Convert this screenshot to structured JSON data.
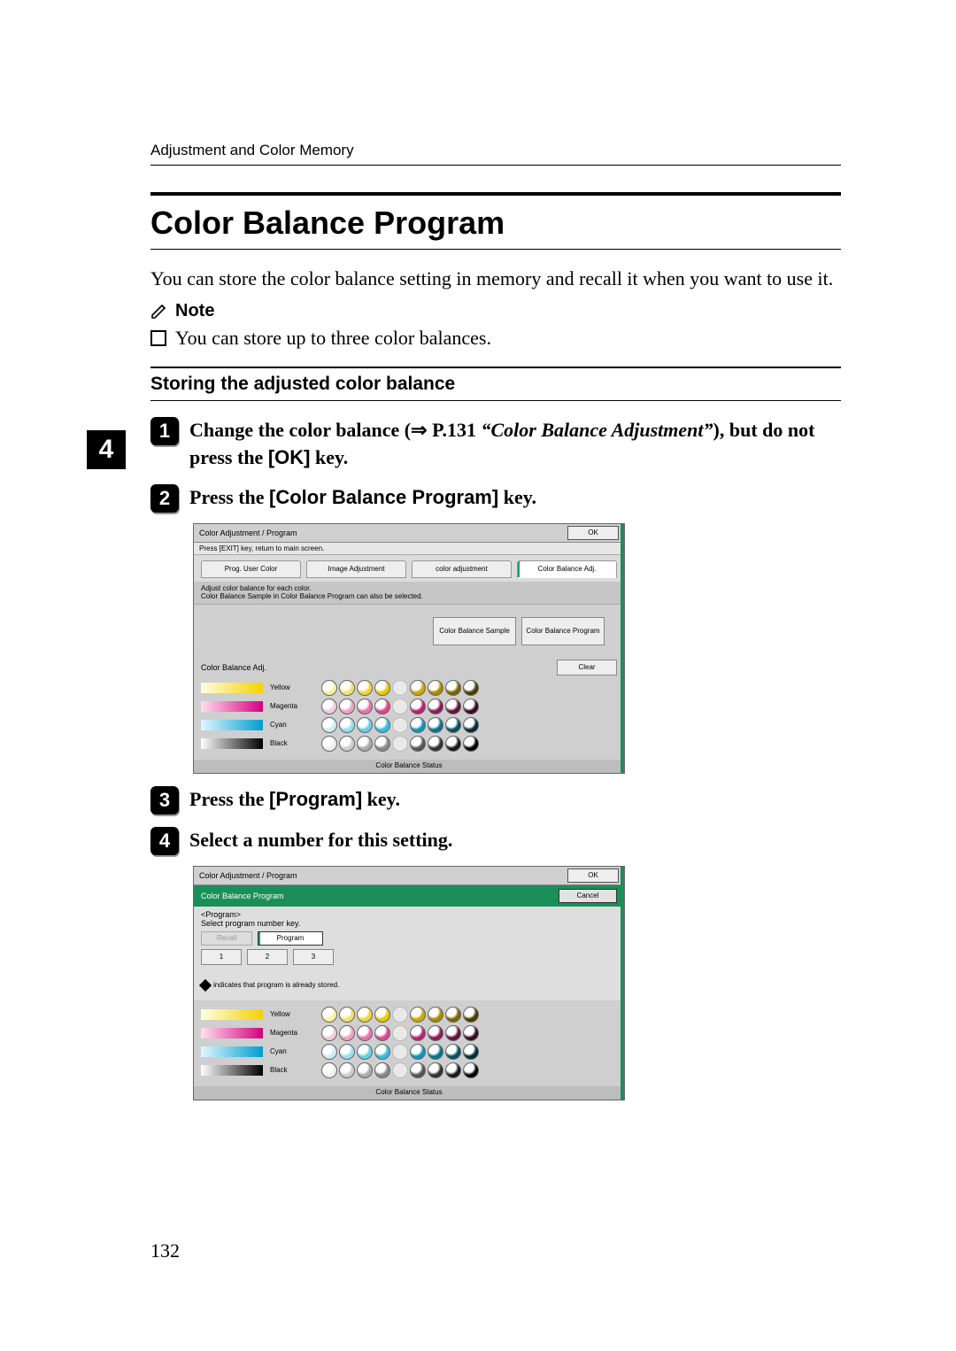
{
  "chapter_tab": "4",
  "page_number": "132",
  "running_head": "Adjustment and Color Memory",
  "section": {
    "title": "Color Balance Program",
    "intro": "You can store the color balance setting in memory and recall it when you want to use it.",
    "note_label": "Note",
    "note_item": "You can store up to three color balances.",
    "subhead": "Storing the adjusted color balance"
  },
  "steps": {
    "s1_a": "Change the color balance (",
    "s1_arrow": "⇒",
    "s1_b": " P.131 ",
    "s1_ref": "“Color Balance Adjustment”",
    "s1_c": "), but do not press the ",
    "s1_key_ok": "[OK]",
    "s1_d": " key.",
    "s2_a": "Press the ",
    "s2_key": "[Color Balance Program]",
    "s2_b": " key.",
    "s3_a": "Press the ",
    "s3_key": "[Program]",
    "s3_b": " key.",
    "s4": "Select a number for this setting."
  },
  "shot1": {
    "title": "Color Adjustment / Program",
    "ok": "OK",
    "subbar": "Press [EXIT] key, return to main screen.",
    "tabs": [
      "Prog. User Color",
      "Image Adjustment",
      "color adjustment",
      "Color Balance Adj."
    ],
    "desc1": "Adjust color balance for each color.",
    "desc2": "Color Balance Sample in Color Balance Program can also be selected.",
    "btn_sample": "Color Balance Sample",
    "btn_program": "Color Balance Program",
    "adj_label": "Color Balance Adj.",
    "clear": "Clear",
    "rows": [
      "Yellow",
      "Magenta",
      "Cyan",
      "Black"
    ],
    "footer": "Color Balance Status"
  },
  "shot2": {
    "title": "Color Adjustment / Program",
    "ok": "OK",
    "greenbar_title": "Color Balance Program",
    "cancel": "Cancel",
    "program_label": "<Program>",
    "program_hint": "Select program number key.",
    "recall": "Recall",
    "program": "Program",
    "numbers": [
      "1",
      "2",
      "3"
    ],
    "stored_hint": "indicates that program is already stored.",
    "rows": [
      "Yellow",
      "Magenta",
      "Cyan",
      "Black"
    ],
    "footer": "Color Balance Status"
  }
}
